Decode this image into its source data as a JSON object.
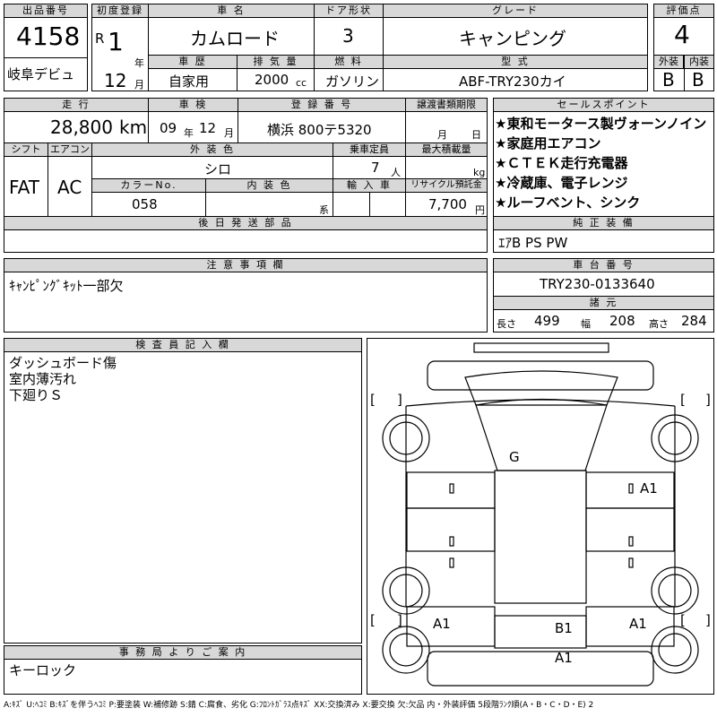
{
  "header": {
    "lot_label": "出品番号",
    "lot_no": "4158",
    "debut": "岐阜デビュ",
    "first_reg_label": "初度登録",
    "era": "R",
    "year": "1",
    "year_unit": "年",
    "month": "12",
    "month_unit": "月",
    "car_name_label": "車 名",
    "car_name": "カムロード",
    "door_label": "ドア形状",
    "door": "3",
    "grade_label": "グレード",
    "grade": "キャンピング",
    "score_label": "評価点",
    "score": "4",
    "history_label": "車 歴",
    "history": "自家用",
    "disp_label": "排 気 量",
    "disp": "2000",
    "disp_unit": "cc",
    "fuel_label": "燃 料",
    "fuel": "ガソリン",
    "model_label": "型 式",
    "model": "ABF-TRY230カイ",
    "ext_label": "外装",
    "ext": "B",
    "int_label": "内装",
    "int": "B"
  },
  "mid": {
    "mileage_label": "走 行",
    "mileage": "28,800",
    "mileage_unit": "km",
    "inspect_label": "車 検",
    "inspect_y": "09",
    "inspect_y_unit": "年",
    "inspect_m": "12",
    "inspect_m_unit": "月",
    "plate_label": "登 録 番 号",
    "plate": "横浜 800テ5320",
    "transfer_label": "譲渡書類期限",
    "transfer_m": "月",
    "transfer_d": "日",
    "shift_label": "シフト",
    "shift": "FAT",
    "ac_label": "エアコン",
    "ac": "AC",
    "color_label": "外 装 色",
    "color": "シロ",
    "cap_label": "乗車定員",
    "cap": "7",
    "cap_unit": "人",
    "load_label": "最大積載量",
    "load_unit": "kg",
    "colorno_label": "カラーNo.",
    "colorno": "058",
    "intcolor_label": "内 装 色",
    "intcolor_unit": "系",
    "import_label": "輸 入 車",
    "recycle_label": "リサイクル預託金",
    "recycle": "7,700",
    "recycle_unit": "円",
    "later_label": "後 日 発 送 部 品"
  },
  "sales": {
    "label": "セールスポイント",
    "points": [
      "★東和モータース製ヴォーンノイン",
      "★家庭用エアコン",
      "★ＣＴＥＫ走行充電器",
      "★冷蔵庫、電子レンジ",
      "★ルーフベント、シンク"
    ],
    "equip_label": "純 正 装 備",
    "equip": "ｴｱB PS PW"
  },
  "notes": {
    "label": "注 意 事 項 欄",
    "text": "ｷｬﾝﾋﾟﾝｸﾞｷｯﾄ一部欠"
  },
  "chassis": {
    "label": "車 台 番 号",
    "number": "TRY230-0133640",
    "spec_label": "諸 元",
    "len_label": "長さ",
    "len": "499",
    "wid_label": "幅",
    "wid": "208",
    "hgt_label": "高さ",
    "hgt": "284"
  },
  "inspector": {
    "label": "検 査 員 記 入 欄",
    "lines": [
      "ダッシュボード傷",
      "室内薄汚れ",
      "下廻りＳ"
    ]
  },
  "office": {
    "label": "事 務 局 よ り ご 案 内",
    "text": "キーロック"
  },
  "diagram": {
    "marks": [
      "G",
      "A1",
      "A1",
      "A1",
      "B1",
      "A1"
    ],
    "bracket_open": "[",
    "bracket_close": "]"
  },
  "legend": "A:ｷｽﾞ U:ﾍｺﾐ B:ｷｽﾞを伴うﾍｺﾐ P:要塗装 W:補修跡 S:錆 C:腐食、劣化 G:ﾌﾛﾝﾄｶﾞﾗｽ点ｷｽﾞ XX:交換済み X:要交換 欠:欠品 内・外装評価 5段階ﾗﾝｸ順(A・B・C・D・E) 2"
}
